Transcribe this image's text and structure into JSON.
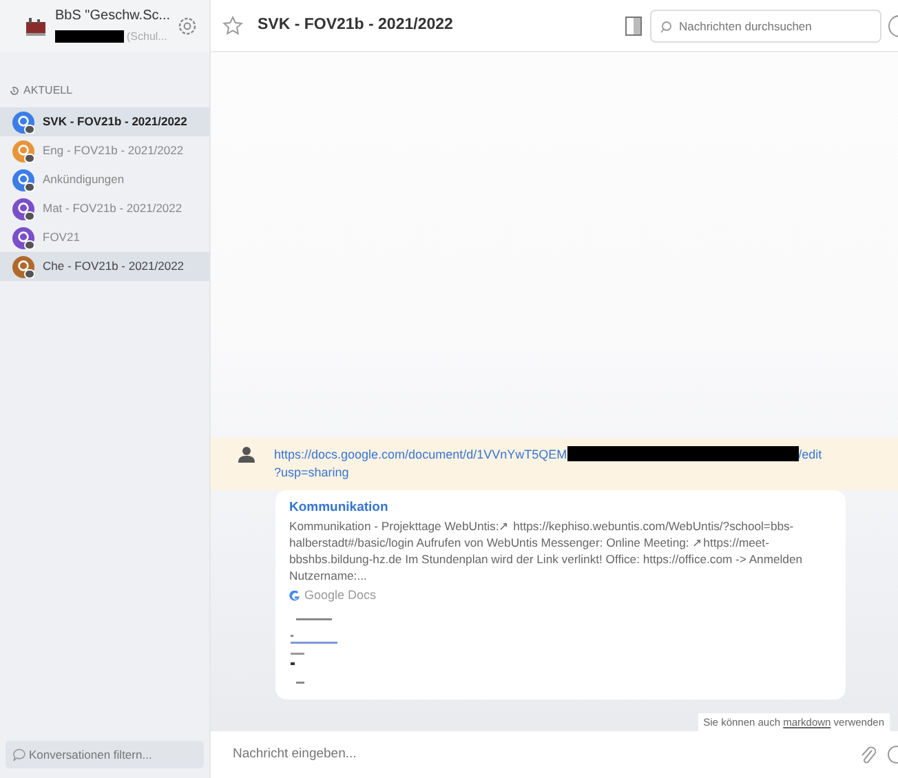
{
  "sidebar": {
    "org_name": "BbS \"Geschw.Sc...",
    "org_subtitle": "(Schul...",
    "section_label": "AKTUELL",
    "conversations": [
      {
        "name": "SVK - FOV21b - 2021/2022",
        "color": "#3c7de6",
        "selected": true,
        "hovered": false
      },
      {
        "name": "Eng - FOV21b - 2021/2022",
        "color": "#e8943a",
        "selected": false,
        "hovered": false
      },
      {
        "name": "Ankündigungen",
        "color": "#3c7de6",
        "selected": false,
        "hovered": false
      },
      {
        "name": "Mat - FOV21b - 2021/2022",
        "color": "#7a4fc8",
        "selected": false,
        "hovered": false
      },
      {
        "name": "FOV21",
        "color": "#7a4fc8",
        "selected": false,
        "hovered": false
      },
      {
        "name": "Che - FOV21b - 2021/2022",
        "color": "#b0692c",
        "selected": false,
        "hovered": true
      }
    ],
    "filter": {
      "placeholder": "Konversationen filtern..."
    }
  },
  "header": {
    "title": "SVK - FOV21b - 2021/2022",
    "search": {
      "placeholder": "Nachrichten durchsuchen"
    }
  },
  "message": {
    "link_start": "https://docs.google.com/document/d/1VVnYwT5QEM",
    "link_end": "/edit",
    "link_tail": "?usp=sharing",
    "preview": {
      "title": "Kommunikation",
      "description": "Kommunikation - Projekttage WebUntis:↗ https://kephiso.webuntis.com/WebUntis/?school=bbs-halberstadt#/basic/login Aufrufen von WebUntis Messenger: Online Meeting: ↗https://meet-bbshbs.bildung-hz.de Im Stundenplan wird der Link verlinkt! Office: https://office.com -> Anmelden Nutzername:...",
      "source": "Google Docs"
    }
  },
  "composer": {
    "hint_before": "Sie können auch",
    "hint_link": "markdown",
    "hint_after": "verwenden",
    "placeholder": "Nachricht eingeben..."
  }
}
